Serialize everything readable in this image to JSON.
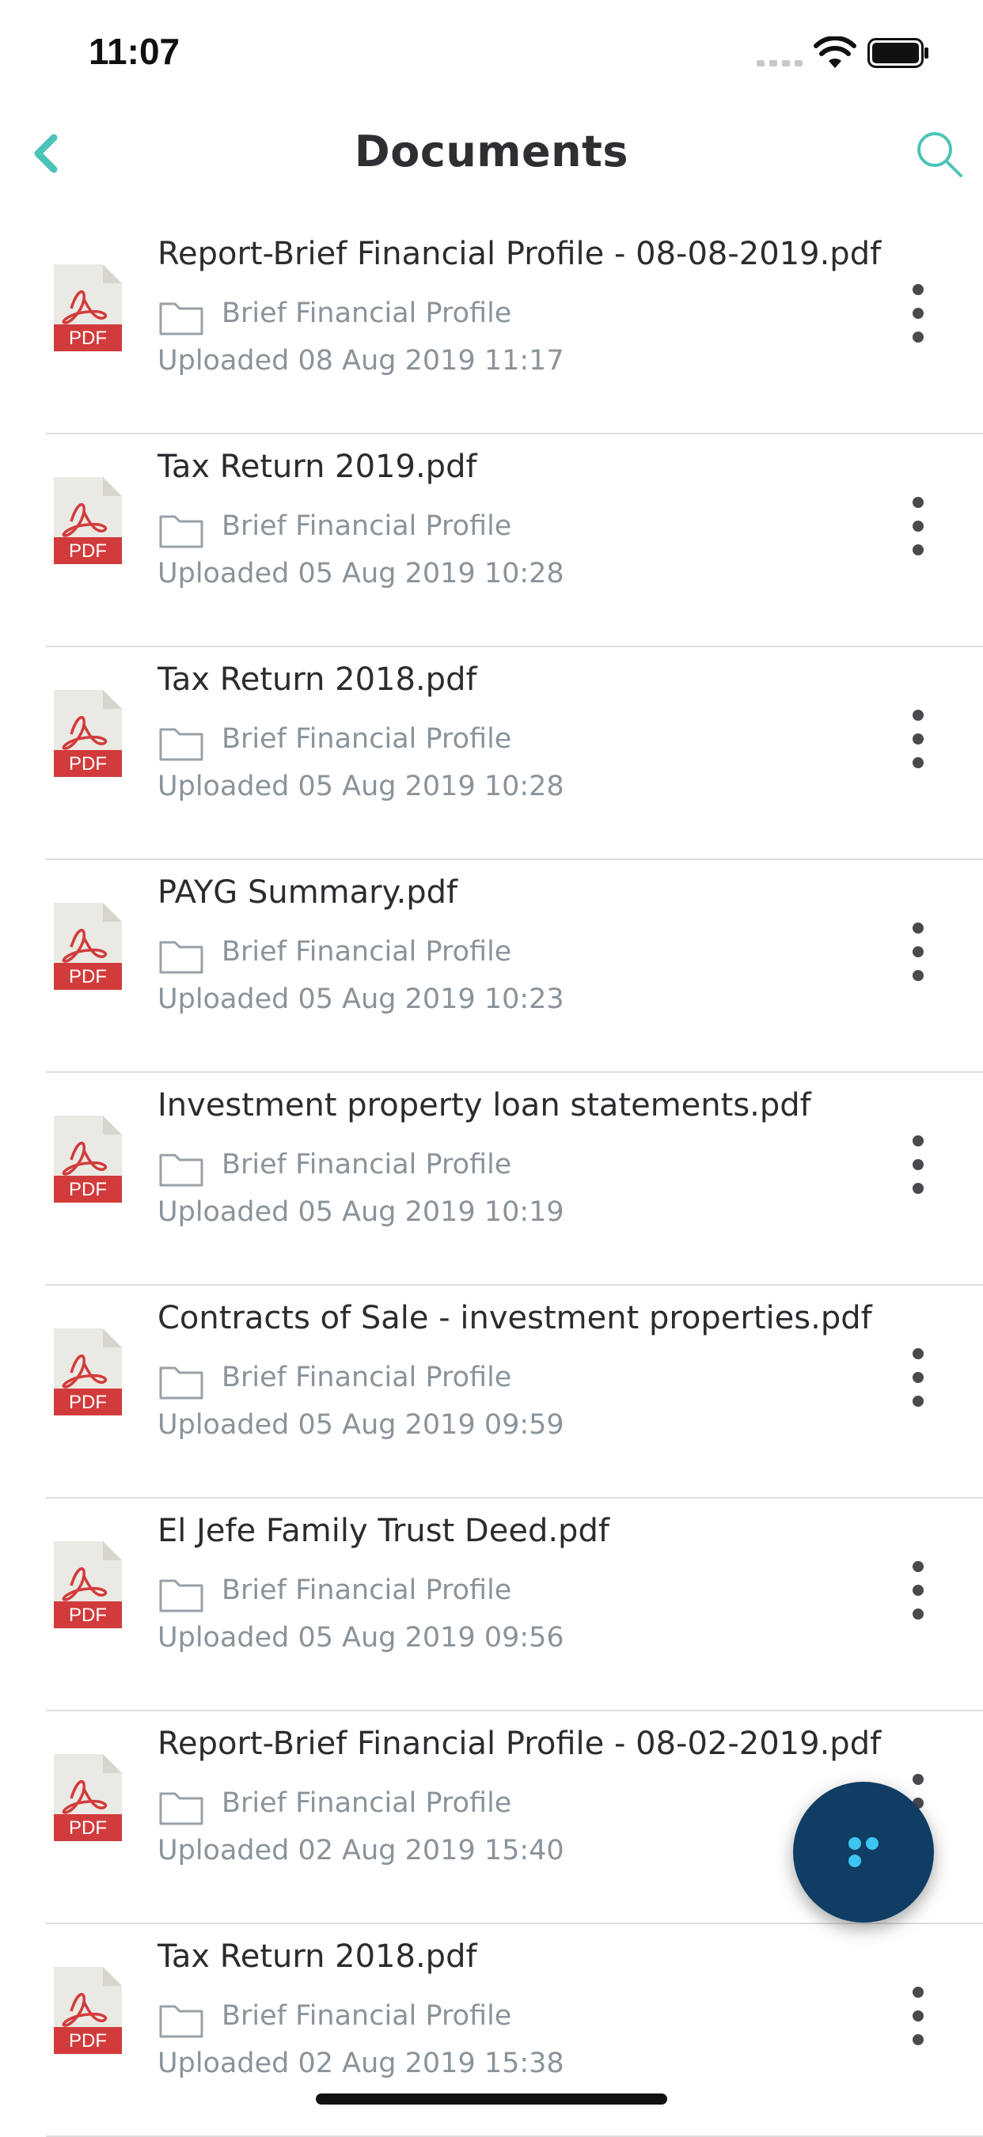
{
  "status_bar": {
    "time": "11:07"
  },
  "nav": {
    "title": "Documents"
  },
  "colors": {
    "accent": "#4cc3b8",
    "pdf_red": "#d23b3b",
    "fab": "#0f3d63",
    "fab_dots": "#3ec6f0"
  },
  "documents": [
    {
      "name": "Report-Brief Financial Profile - 08-08-2019.pdf",
      "folder": "Brief Financial Profile",
      "uploaded": "Uploaded 08 Aug 2019 11:17",
      "badge": "PDF"
    },
    {
      "name": "Tax Return 2019.pdf",
      "folder": "Brief Financial Profile",
      "uploaded": "Uploaded 05 Aug 2019 10:28",
      "badge": "PDF"
    },
    {
      "name": "Tax Return 2018.pdf",
      "folder": "Brief Financial Profile",
      "uploaded": "Uploaded 05 Aug 2019 10:28",
      "badge": "PDF"
    },
    {
      "name": "PAYG Summary.pdf",
      "folder": "Brief Financial Profile",
      "uploaded": "Uploaded 05 Aug 2019 10:23",
      "badge": "PDF"
    },
    {
      "name": "Investment property loan statements.pdf",
      "folder": "Brief Financial Profile",
      "uploaded": "Uploaded 05 Aug 2019 10:19",
      "badge": "PDF"
    },
    {
      "name": "Contracts of Sale - investment properties.pdf",
      "folder": "Brief Financial Profile",
      "uploaded": "Uploaded 05 Aug 2019 09:59",
      "badge": "PDF"
    },
    {
      "name": "El Jefe Family Trust Deed.pdf",
      "folder": "Brief Financial Profile",
      "uploaded": "Uploaded 05 Aug 2019 09:56",
      "badge": "PDF"
    },
    {
      "name": "Report-Brief Financial Profile - 08-02-2019.pdf",
      "folder": "Brief Financial Profile",
      "uploaded": "Uploaded 02 Aug 2019 15:40",
      "badge": "PDF"
    },
    {
      "name": "Tax Return 2018.pdf",
      "folder": "Brief Financial Profile",
      "uploaded": "Uploaded 02 Aug 2019 15:38",
      "badge": "PDF"
    }
  ]
}
